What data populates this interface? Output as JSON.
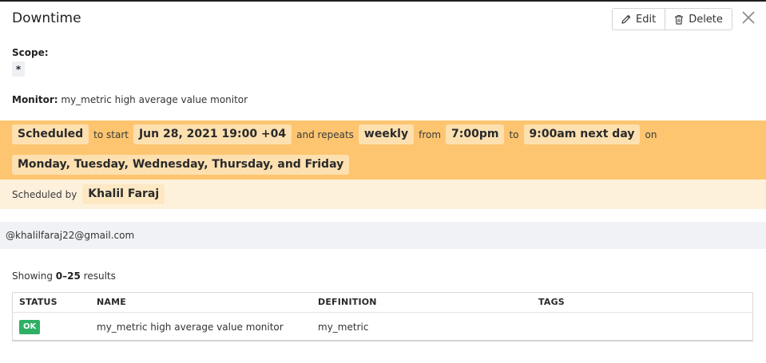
{
  "header": {
    "title": "Downtime",
    "edit_label": "Edit",
    "delete_label": "Delete"
  },
  "scope": {
    "label": "Scope:",
    "value": "*"
  },
  "monitor": {
    "label": "Monitor:",
    "value": "my_metric high average value monitor"
  },
  "schedule": {
    "status": "Scheduled",
    "to_start": "to start",
    "start": "Jun 28, 2021 19:00 +04",
    "and_repeats": "and repeats",
    "frequency": "weekly",
    "from": "from",
    "from_time": "7:00pm",
    "to": "to",
    "to_time": "9:00am next day",
    "on": "on",
    "days": "Monday, Tuesday, Wednesday, Thursday, and Friday"
  },
  "scheduled_by": {
    "label": "Scheduled by",
    "name": "Khalil Faraj"
  },
  "email": "@khalilfaraj22@gmail.com",
  "results": {
    "prefix": "Showing",
    "range": "0–25",
    "suffix": "results"
  },
  "table": {
    "columns": [
      "STATUS",
      "NAME",
      "DEFINITION",
      "TAGS"
    ],
    "rows": [
      {
        "status": "OK",
        "name": "my_metric high average value monitor",
        "definition": "my_metric",
        "tags": ""
      }
    ]
  },
  "colors": {
    "schedule_bg": "#fdc570",
    "scheduled_by_bg": "#fef1dc",
    "ok_badge": "#2fb065"
  },
  "icons": {
    "edit": "pencil-icon",
    "delete": "trash-icon",
    "close": "close-icon"
  }
}
